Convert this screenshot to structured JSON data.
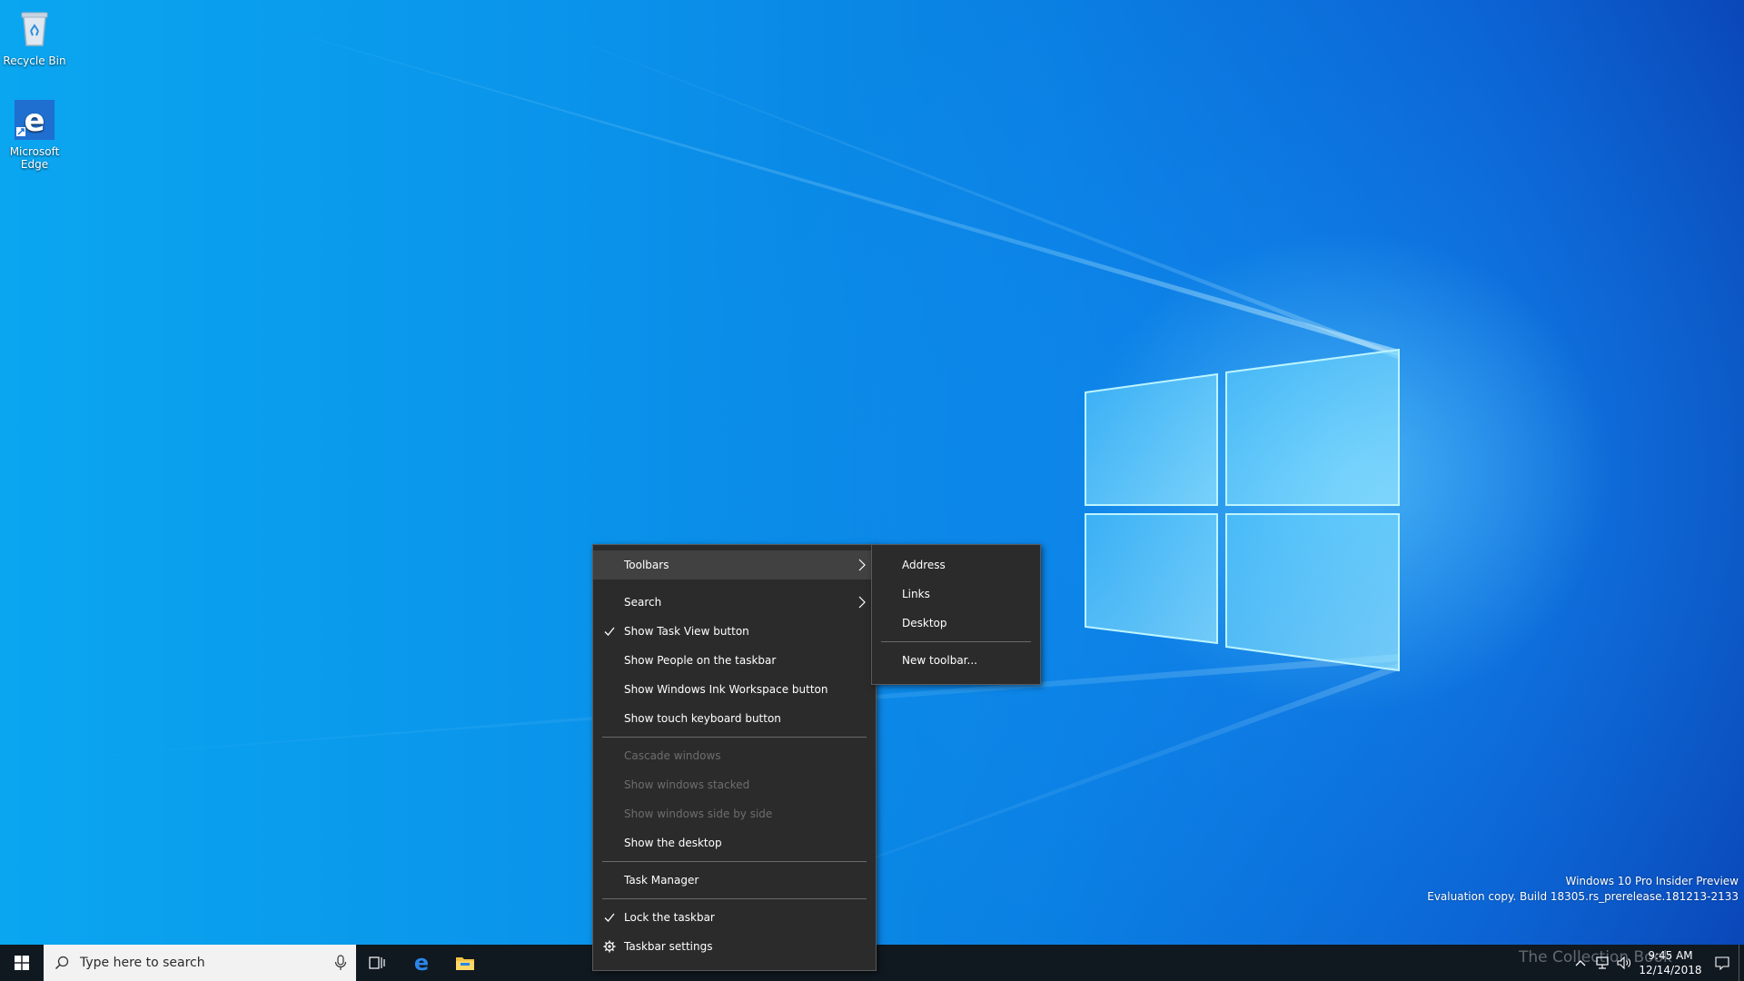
{
  "desktop": {
    "icons": [
      {
        "label": "Recycle Bin",
        "icon": "recycle-bin-icon"
      },
      {
        "label": "Microsoft Edge",
        "icon": "edge-icon"
      }
    ]
  },
  "watermark": {
    "line1": "Windows 10 Pro Insider Preview",
    "line2": "Evaluation copy. Build 18305.rs_prerelease.181213-2133",
    "overlay_text": "The Collection Book"
  },
  "taskbar": {
    "search_placeholder": "Type here to search",
    "pinned": [
      "task-view-icon",
      "edge-icon",
      "file-explorer-icon"
    ],
    "clock": {
      "time": "9:45 AM",
      "date": "12/14/2018"
    },
    "colors": {
      "background": "#101820",
      "search_bg": "#f2f2f2"
    }
  },
  "context_menu": {
    "items": [
      {
        "label": "Toolbars",
        "submenu": true,
        "highlighted": true
      },
      {
        "label": "Search",
        "submenu": true
      },
      {
        "label": "Show Task View button",
        "checked": true
      },
      {
        "label": "Show People on the taskbar"
      },
      {
        "label": "Show Windows Ink Workspace button"
      },
      {
        "label": "Show touch keyboard button"
      },
      {
        "label": "Cascade windows",
        "disabled": true
      },
      {
        "label": "Show windows stacked",
        "disabled": true
      },
      {
        "label": "Show windows side by side",
        "disabled": true
      },
      {
        "label": "Show the desktop"
      },
      {
        "label": "Task Manager"
      },
      {
        "label": "Lock the taskbar",
        "checked": true
      },
      {
        "label": "Taskbar settings",
        "icon": "gear-icon"
      }
    ],
    "colors": {
      "background": "#2b2b2b",
      "highlight": "#414141",
      "disabled_text": "#6d6d6d"
    }
  },
  "toolbars_submenu": {
    "items": [
      {
        "label": "Address"
      },
      {
        "label": "Links"
      },
      {
        "label": "Desktop"
      },
      {
        "label": "New toolbar..."
      }
    ]
  }
}
